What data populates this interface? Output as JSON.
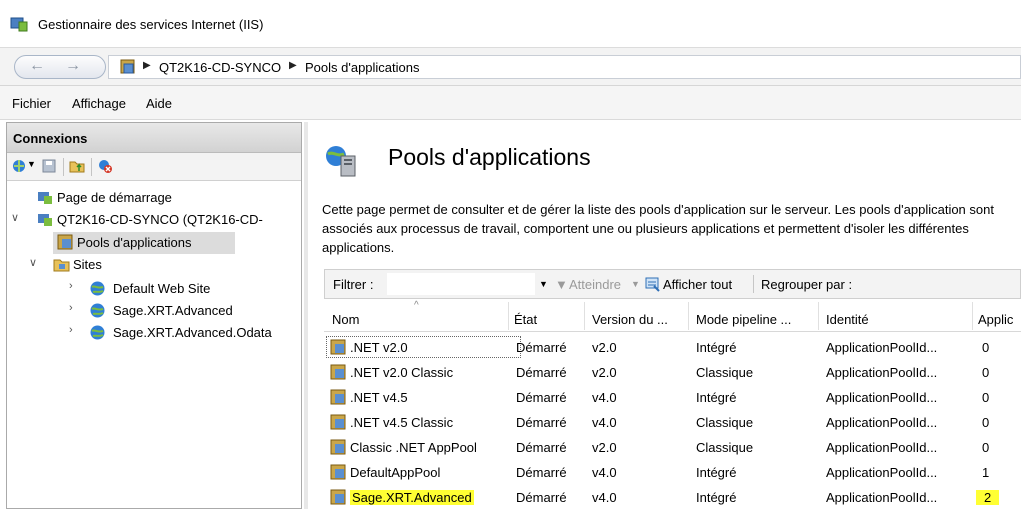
{
  "window": {
    "title": "Gestionnaire des services Internet (IIS)"
  },
  "address": {
    "crumbs": [
      "QT2K16-CD-SYNCO",
      "Pools d'applications"
    ]
  },
  "menu": {
    "items": [
      "Fichier",
      "Affichage",
      "Aide"
    ]
  },
  "connections": {
    "header": "Connexions",
    "tree": {
      "start_page": "Page de démarrage",
      "server": "QT2K16-CD-SYNCO (QT2K16-CD-",
      "app_pools": "Pools d'applications",
      "sites": "Sites",
      "site_items": [
        "Default Web Site",
        "Sage.XRT.Advanced",
        "Sage.XRT.Advanced.Odata"
      ]
    }
  },
  "page": {
    "title": "Pools d'applications",
    "description": "Cette page permet de consulter et de gérer la liste des pools d'application sur le serveur. Les pools d'application sont associés aux processus de travail, comportent une ou plusieurs applications et permettent d'isoler les différentes applications."
  },
  "filter": {
    "label": "Filtrer :",
    "go": "Atteindre",
    "show_all": "Afficher tout",
    "group_by": "Regrouper par :"
  },
  "grid": {
    "columns": [
      "Nom",
      "État",
      "Version du ...",
      "Mode pipeline ...",
      "Identité",
      "Applic"
    ],
    "rows": [
      {
        "name": ".NET v2.0",
        "state": "Démarré",
        "version": "v2.0",
        "mode": "Intégré",
        "identity": "ApplicationPoolId...",
        "apps": "0"
      },
      {
        "name": ".NET v2.0 Classic",
        "state": "Démarré",
        "version": "v2.0",
        "mode": "Classique",
        "identity": "ApplicationPoolId...",
        "apps": "0"
      },
      {
        "name": ".NET v4.5",
        "state": "Démarré",
        "version": "v4.0",
        "mode": "Intégré",
        "identity": "ApplicationPoolId...",
        "apps": "0"
      },
      {
        "name": ".NET v4.5 Classic",
        "state": "Démarré",
        "version": "v4.0",
        "mode": "Classique",
        "identity": "ApplicationPoolId...",
        "apps": "0"
      },
      {
        "name": "Classic .NET AppPool",
        "state": "Démarré",
        "version": "v2.0",
        "mode": "Classique",
        "identity": "ApplicationPoolId...",
        "apps": "0"
      },
      {
        "name": "DefaultAppPool",
        "state": "Démarré",
        "version": "v4.0",
        "mode": "Intégré",
        "identity": "ApplicationPoolId...",
        "apps": "1"
      },
      {
        "name": "Sage.XRT.Advanced",
        "state": "Démarré",
        "version": "v4.0",
        "mode": "Intégré",
        "identity": "ApplicationPoolId...",
        "apps": "2"
      }
    ]
  },
  "colors": {
    "highlight": "#ffff33",
    "selection": "#dcdcdc",
    "panel_header": "#d2d2d2"
  }
}
